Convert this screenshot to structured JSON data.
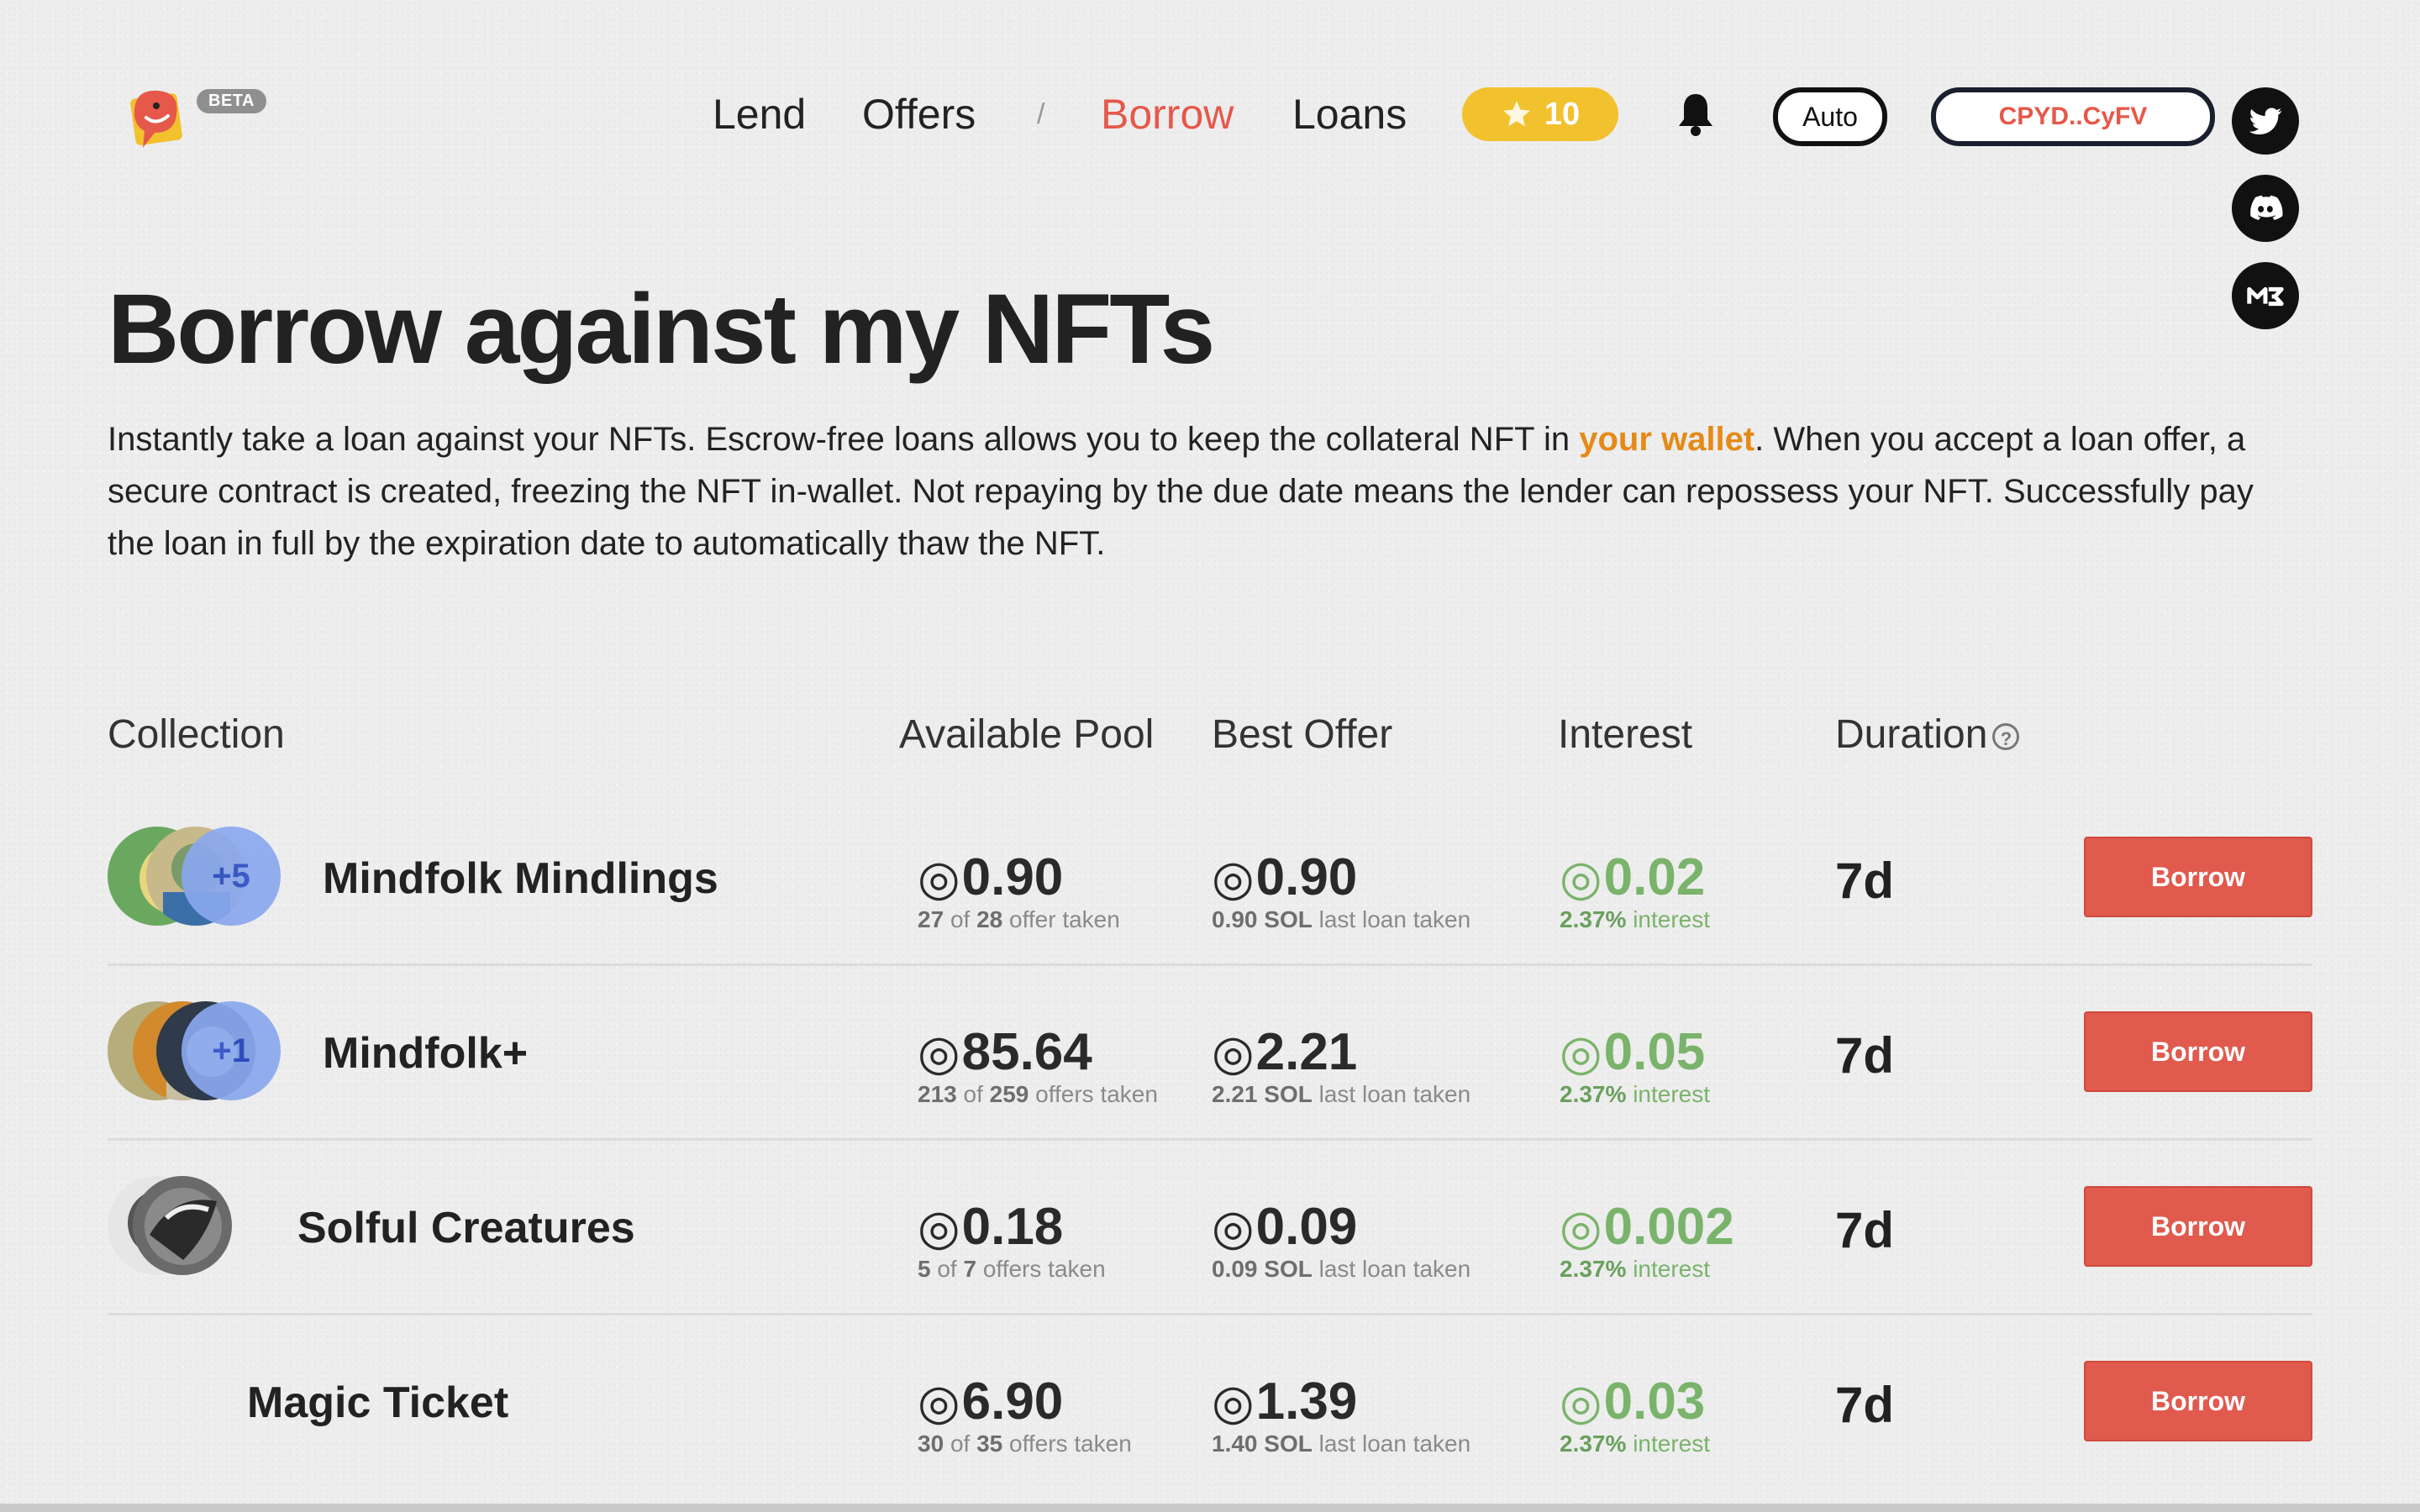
{
  "header": {
    "beta_label": "BETA",
    "nav": [
      {
        "label": "Lend",
        "active": false
      },
      {
        "label": "Offers",
        "active": false
      },
      {
        "label": "Borrow",
        "active": true
      },
      {
        "label": "Loans",
        "active": false
      }
    ],
    "separator": "/",
    "points": "10",
    "auto_label": "Auto",
    "wallet_label": "CPYD..CyFV",
    "social": [
      "twitter-icon",
      "discord-icon",
      "magic-eden-icon"
    ]
  },
  "hero": {
    "title": "Borrow against my NFTs",
    "desc_part1": "Instantly take a loan against your NFTs. Escrow-free loans allows you to keep the collateral NFT in ",
    "desc_highlight": "your wallet",
    "desc_part2": ". When you accept a loan offer, a secure contract is created, freezing the NFT in-wallet. Not repaying by the due date means the lender can repossess your NFT. Successfully pay the loan in full by the expiration date to automatically thaw the NFT."
  },
  "table": {
    "headers": {
      "collection": "Collection",
      "pool": "Available Pool",
      "offer": "Best Offer",
      "interest": "Interest",
      "duration": "Duration"
    },
    "currency_symbol": "◎",
    "of_text": "of",
    "sol_text": "SOL",
    "rows": [
      {
        "name": "Mindfolk Mindlings",
        "more": "+5",
        "pool": "0.90",
        "pool_taken": "27",
        "pool_total": "28",
        "pool_suffix": "offer taken",
        "offer": "0.90",
        "offer_sol": "0.90",
        "offer_suffix": "last loan taken",
        "interest": "0.02",
        "interest_rate": "2.37%",
        "interest_suffix": "interest",
        "duration": "7d",
        "button": "Borrow"
      },
      {
        "name": "Mindfolk+",
        "more": "+1",
        "pool": "85.64",
        "pool_taken": "213",
        "pool_total": "259",
        "pool_suffix": "offers taken",
        "offer": "2.21",
        "offer_sol": "2.21",
        "offer_suffix": "last loan taken",
        "interest": "0.05",
        "interest_rate": "2.37%",
        "interest_suffix": "interest",
        "duration": "7d",
        "button": "Borrow"
      },
      {
        "name": "Solful Creatures",
        "more": "",
        "pool": "0.18",
        "pool_taken": "5",
        "pool_total": "7",
        "pool_suffix": "offers taken",
        "offer": "0.09",
        "offer_sol": "0.09",
        "offer_suffix": "last loan taken",
        "interest": "0.002",
        "interest_rate": "2.37%",
        "interest_suffix": "interest",
        "duration": "7d",
        "button": "Borrow"
      },
      {
        "name": "Magic Ticket",
        "more": "",
        "pool": "6.90",
        "pool_taken": "30",
        "pool_total": "35",
        "pool_suffix": "offers taken",
        "offer": "1.39",
        "offer_sol": "1.40",
        "offer_suffix": "last loan taken",
        "interest": "0.03",
        "interest_rate": "2.37%",
        "interest_suffix": "interest",
        "duration": "7d",
        "button": "Borrow"
      }
    ]
  },
  "colors": {
    "accent_red": "#e05a4e",
    "highlight_orange": "#e58a18",
    "interest_green": "#7ab36b",
    "points_yellow": "#f2c12e"
  }
}
